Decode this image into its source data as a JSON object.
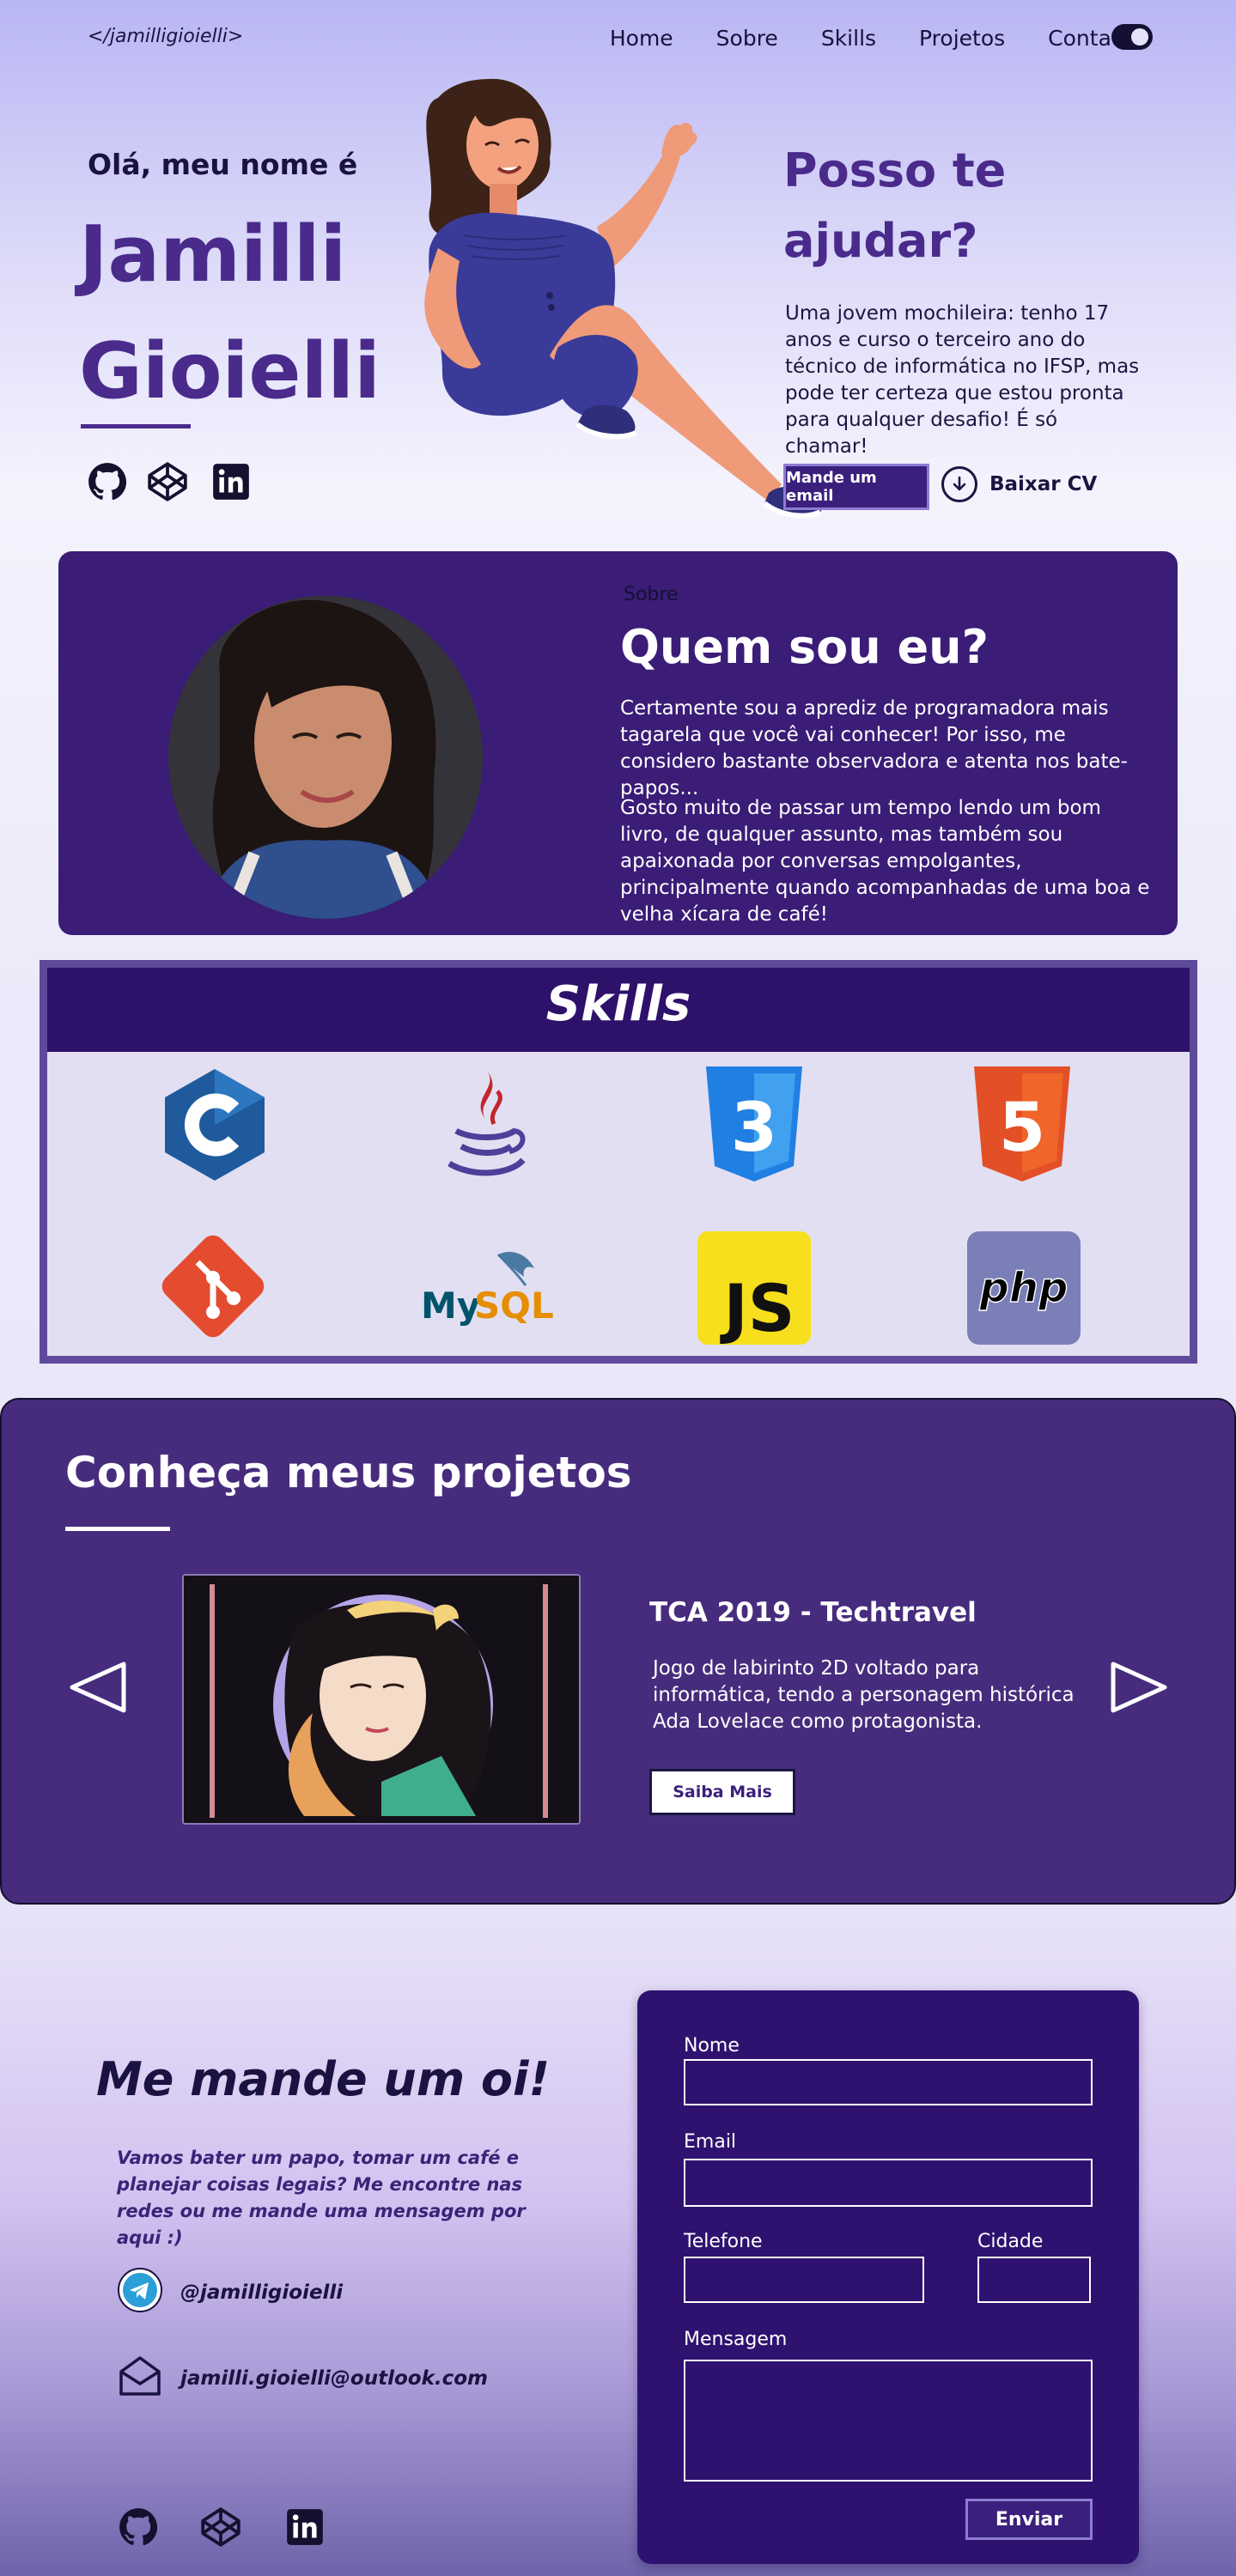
{
  "nav": {
    "logo": "</jamilligioielli>",
    "links": [
      "Home",
      "Sobre",
      "Skills",
      "Projetos",
      "Contato"
    ],
    "theme_toggle_icon": "toggle-icon"
  },
  "hero": {
    "greeting": "Olá, meu nome é",
    "first_name": "Jamilli",
    "last_name": "Gioielli",
    "social_icons": [
      "github-icon",
      "codepen-icon",
      "linkedin-icon"
    ],
    "help_title": "Posso te ajudar?",
    "help_text": "Uma jovem mochileira: tenho 17 anos e curso o terceiro ano do técnico de informática no IFSP, mas pode ter certeza que estou pronta para qualquer desafio! É só chamar!",
    "email_button": "Mande um email",
    "cv_button": "Baixar CV"
  },
  "about": {
    "kicker": "Sobre",
    "title": "Quem sou eu?",
    "paragraph1": "Certamente sou a aprediz de programadora mais tagarela que você vai conhecer! Por isso, me considero bastante observadora e atenta nos bate-papos...",
    "paragraph2": "Gosto muito de passar um tempo lendo um bom livro, de qualquer assunto, mas também sou apaixonada por conversas empolgantes, principalmente quando acompanhadas de uma boa e velha xícara de café!"
  },
  "skills": {
    "title": "Skills",
    "icons": [
      "c-icon",
      "java-icon",
      "css3-icon",
      "html5-icon",
      "git-icon",
      "mysql-icon",
      "javascript-icon",
      "php-icon"
    ],
    "logo_text": {
      "css": "3",
      "html": "5",
      "mysql_my": "My",
      "mysql_sql": "SQL",
      "js": "JS",
      "php": "php"
    }
  },
  "projects": {
    "title": "Conheça meus projetos",
    "items": [
      {
        "name": "TCA 2019 - Techtravel",
        "description": "Jogo de labirinto 2D voltado para informática, tendo a personagem histórica Ada Lovelace como protagonista.",
        "button": "Saiba Mais"
      }
    ]
  },
  "contact": {
    "title": "Me mande um oi!",
    "text": "Vamos bater um papo, tomar um café e planejar coisas legais? Me encontre nas redes ou me mande uma mensagem por aqui :)",
    "telegram": "@jamilligioielli",
    "email": "jamilli.gioielli@outlook.com",
    "form": {
      "name_label": "Nome",
      "email_label": "Email",
      "phone_label": "Telefone",
      "city_label": "Cidade",
      "message_label": "Mensagem",
      "send_button": "Enviar"
    }
  },
  "colors": {
    "primary": "#4a2b8c",
    "dark_purple": "#2f1270",
    "card_purple": "#3b1c77",
    "projects_bg": "#472c7d"
  }
}
